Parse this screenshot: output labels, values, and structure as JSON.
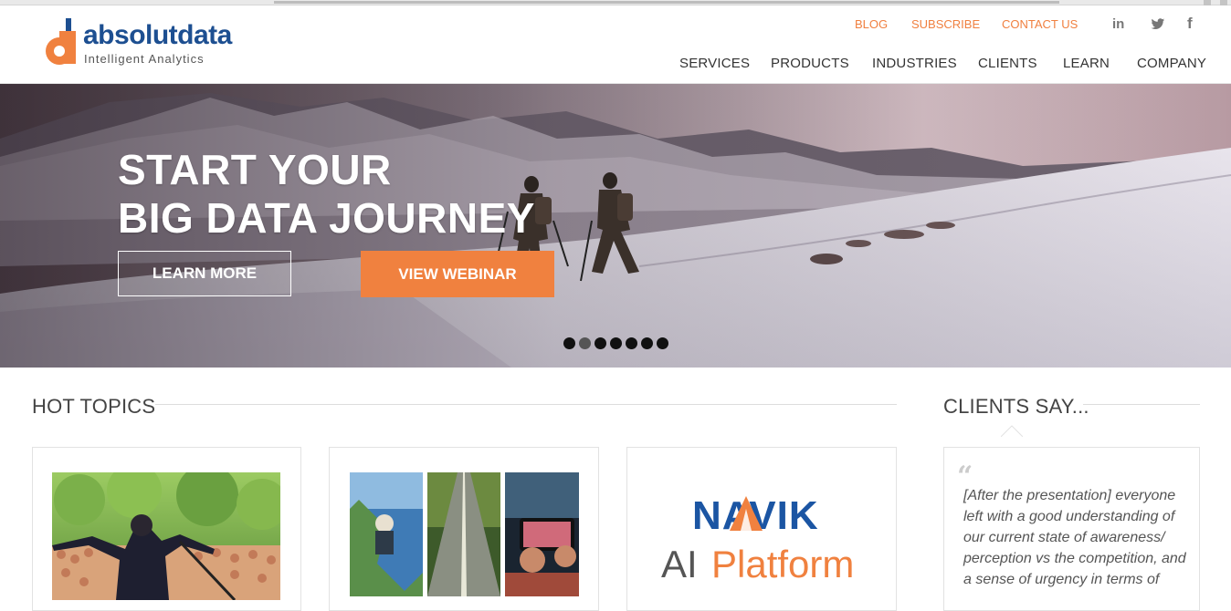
{
  "brand": {
    "name": "absolutdata",
    "tagline": "Intelligent Analytics"
  },
  "utility_nav": [
    {
      "label": "BLOG"
    },
    {
      "label": "SUBSCRIBE"
    },
    {
      "label": "CONTACT US"
    }
  ],
  "social": [
    {
      "icon": "linkedin-icon",
      "glyph": "in"
    },
    {
      "icon": "twitter-icon",
      "glyph": "🐦"
    },
    {
      "icon": "facebook-icon",
      "glyph": "f"
    }
  ],
  "main_nav": [
    {
      "label": "SERVICES"
    },
    {
      "label": "PRODUCTS"
    },
    {
      "label": "INDUSTRIES"
    },
    {
      "label": "CLIENTS"
    },
    {
      "label": "LEARN"
    },
    {
      "label": "COMPANY"
    }
  ],
  "hero": {
    "title_line1": "START YOUR",
    "title_line2": "BIG DATA JOURNEY",
    "learn_more": "LEARN MORE",
    "view_webinar": "VIEW WEBINAR",
    "slide_count": 7,
    "active_slide": 2
  },
  "hot_topics": {
    "title": "HOT TOPICS",
    "cards": [
      {
        "image": "concert-performer-photo"
      },
      {
        "image": "three-panel-photo-collage"
      },
      {
        "image": "navik-ai-platform-logo",
        "logo_word": "NAVIK",
        "logo_sub_1": "AI",
        "logo_sub_2": "Platform"
      }
    ]
  },
  "clients_say": {
    "title": "CLIENTS SAY...",
    "quote_mark": "“",
    "quote": "[After the presentation] everyone left with a good understanding of our current state of awareness/ perception vs the competition, and a sense of urgency in terms of"
  },
  "colors": {
    "accent": "#f0813f",
    "brand_blue": "#1d4f91",
    "navik_blue": "#1b55a3"
  }
}
